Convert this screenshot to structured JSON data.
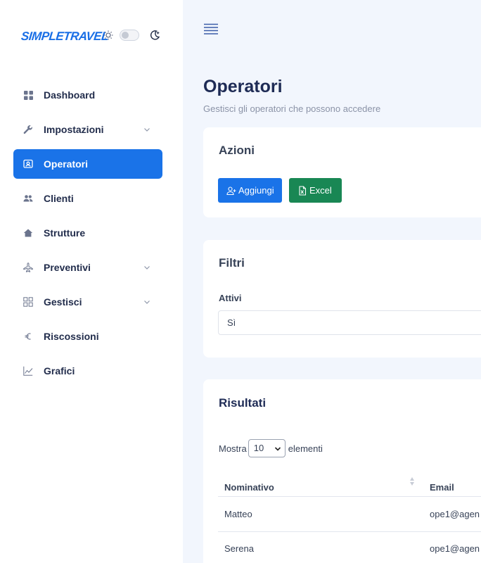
{
  "brand": {
    "logo": "SIMPLETRAVEL"
  },
  "sidebar": {
    "items": [
      {
        "label": "Dashboard",
        "icon": "grid-icon",
        "has_chevron": false,
        "active": false
      },
      {
        "label": "Impostazioni",
        "icon": "wrench-icon",
        "has_chevron": true,
        "active": false
      },
      {
        "label": "Operatori",
        "icon": "user-badge-icon",
        "has_chevron": false,
        "active": true
      },
      {
        "label": "Clienti",
        "icon": "users-icon",
        "has_chevron": false,
        "active": false
      },
      {
        "label": "Strutture",
        "icon": "home-icon",
        "has_chevron": false,
        "active": false
      },
      {
        "label": "Preventivi",
        "icon": "plane-icon",
        "has_chevron": true,
        "active": false
      },
      {
        "label": "Gestisci",
        "icon": "modules-icon",
        "has_chevron": true,
        "active": false
      },
      {
        "label": "Riscossioni",
        "icon": "euro-icon",
        "has_chevron": false,
        "active": false
      },
      {
        "label": "Grafici",
        "icon": "chart-line-icon",
        "has_chevron": false,
        "active": false
      }
    ]
  },
  "header": {
    "title": "Operatori",
    "subtitle": "Gestisci gli operatori che possono accedere"
  },
  "actions": {
    "title": "Azioni",
    "add_label": "Aggiungi",
    "excel_label": "Excel"
  },
  "filters": {
    "title": "Filtri",
    "active_label": "Attivi",
    "active_value": "Sì"
  },
  "results": {
    "title": "Risultati",
    "show_prefix": "Mostra",
    "page_size": "10",
    "show_suffix": "elementi",
    "columns": [
      "Nominativo",
      "Email"
    ],
    "rows": [
      {
        "name": "Matteo",
        "email": "ope1@agen"
      },
      {
        "name": "Serena",
        "email": "ope1@agen"
      }
    ]
  },
  "colors": {
    "accent": "#1a73e8",
    "excel": "#198754",
    "background": "#f2f6fd"
  }
}
